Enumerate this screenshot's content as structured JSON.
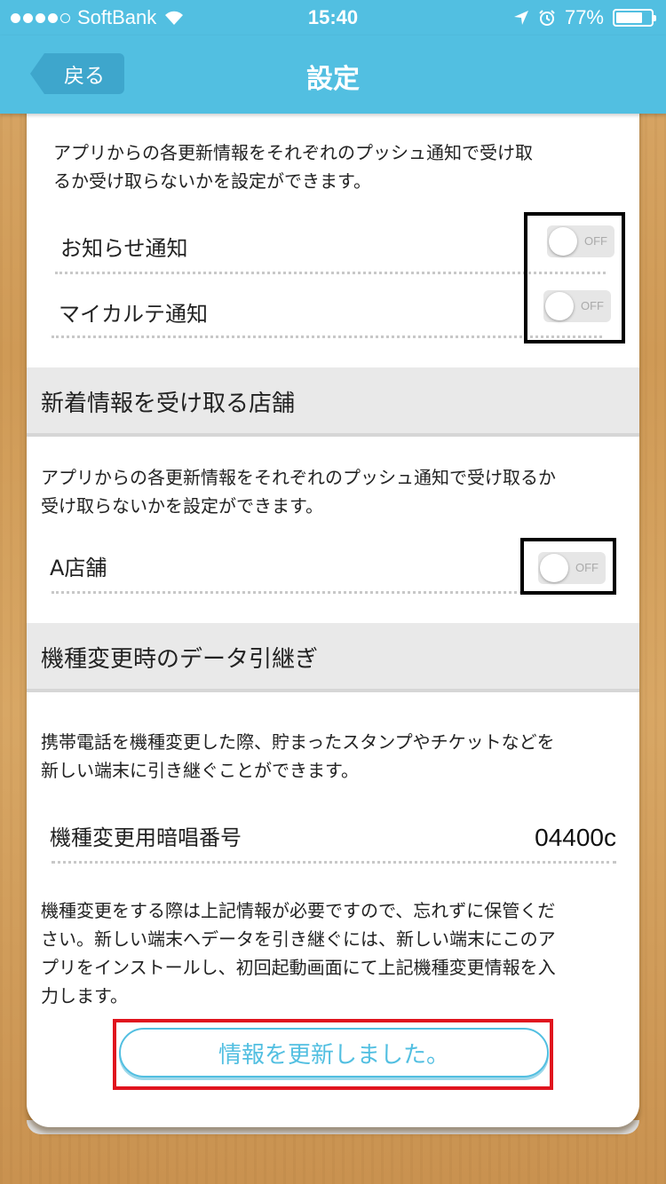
{
  "status_bar": {
    "carrier": "SoftBank",
    "time": "15:40",
    "battery": "77%",
    "battery_level": 0.77,
    "icons": [
      "signal-dots-icon",
      "wifi-icon",
      "location-icon",
      "alarm-icon",
      "battery-icon"
    ]
  },
  "nav": {
    "back_label": "戻る",
    "title": "設定"
  },
  "push_section": {
    "description_lines": [
      "アプリからの各更新情報をそれぞれのプッシュ通知で受け取",
      "るか受け取らないかを設定ができます。"
    ],
    "items": [
      {
        "label": "お知らせ通知",
        "toggle": "OFF"
      },
      {
        "label": "マイカルテ通知",
        "toggle": "OFF"
      }
    ]
  },
  "store_section": {
    "header": "新着情報を受け取る店舗",
    "description_lines": [
      "アプリからの各更新情報をそれぞれのプッシュ通知で受け取るか",
      "受け取らないかを設定ができます。"
    ],
    "items": [
      {
        "label": "A店舗",
        "toggle": "OFF"
      }
    ]
  },
  "transfer_section": {
    "header": "機種変更時のデータ引継ぎ",
    "description_lines": [
      "携帯電話を機種変更した際、貯まったスタンプやチケットなどを",
      "新しい端末に引き継ぐことができます。"
    ],
    "code_label": "機種変更用暗唱番号",
    "code_value": "04400c",
    "note_lines": [
      "機種変更をする際は上記情報が必要ですので、忘れずに保管くだ",
      "さい。新しい端末へデータを引き継ぐには、新しい端末にこのア",
      "プリをインストールし、初回起動画面にて上記機種変更情報を入",
      "力します。"
    ],
    "button_label": "情報を更新しました。"
  },
  "colors": {
    "accent": "#52bfe1",
    "highlight_black": "#000000",
    "highlight_red": "#e0141e"
  }
}
